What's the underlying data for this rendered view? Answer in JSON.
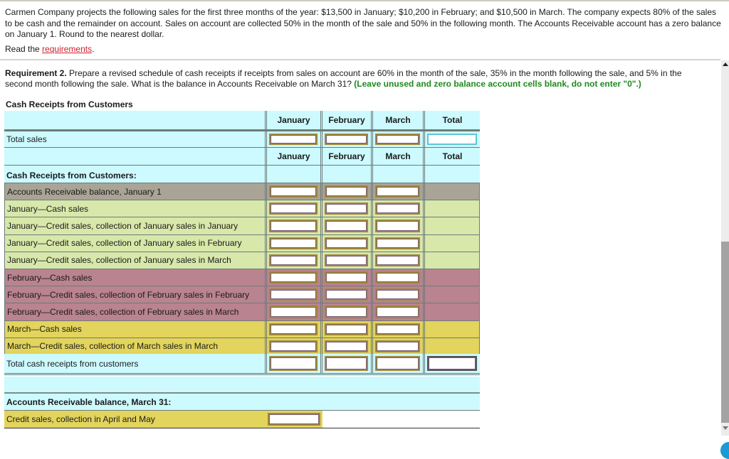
{
  "problem": {
    "intro": "Carmen Company projects the following sales for the first three months of the year: $13,500 in January; $10,200 in February; and $10,500 in March. The company expects 80% of the sales to be cash and the remainder on account. Sales on account are collected 50% in the month of the sale and 50% in the following month. The Accounts Receivable account has a zero balance on January 1. Round to the nearest dollar.",
    "read_prefix": "Read the ",
    "requirements_link": "requirements",
    "read_suffix": "."
  },
  "requirement": {
    "label": "Requirement 2.",
    "text": " Prepare a revised schedule of cash receipts if receipts from sales on account are 60% in the month of the sale, 35% in the month following the sale, and 5% in the second month following the sale. What is the balance in Accounts Receivable on March 31? ",
    "instruction": "(Leave unused and zero balance account cells blank, do not enter \"0\".)"
  },
  "schedule": {
    "title": "Cash Receipts from Customers",
    "columns": [
      "January",
      "February",
      "March",
      "Total"
    ],
    "total_sales_label": "Total sales",
    "total_sales_values": [
      "",
      "",
      "",
      ""
    ],
    "section_label": "Cash Receipts from Customers:",
    "rows": [
      {
        "label": "Accounts Receivable balance, January 1",
        "values": [
          "",
          "",
          ""
        ],
        "color": "#a9a496"
      },
      {
        "label": "January—Cash sales",
        "values": [
          "",
          "",
          ""
        ],
        "color": "#d8e8aa"
      },
      {
        "label": "January—Credit sales, collection of January sales in January",
        "values": [
          "",
          "",
          ""
        ],
        "color": "#d8e8aa"
      },
      {
        "label": "January—Credit sales, collection of January sales in February",
        "values": [
          "",
          "",
          ""
        ],
        "color": "#d8e8aa"
      },
      {
        "label": "January—Credit sales, collection of January sales in March",
        "values": [
          "",
          "",
          ""
        ],
        "color": "#d8e8aa"
      },
      {
        "label": "February—Cash sales",
        "values": [
          "",
          "",
          ""
        ],
        "color": "#b98390"
      },
      {
        "label": "February—Credit sales, collection of February sales in February",
        "values": [
          "",
          "",
          ""
        ],
        "color": "#b98390"
      },
      {
        "label": "February—Credit sales, collection of February sales in March",
        "values": [
          "",
          "",
          ""
        ],
        "color": "#b98390"
      },
      {
        "label": "March—Cash sales",
        "values": [
          "",
          "",
          ""
        ],
        "color": "#e2d45c"
      },
      {
        "label": "March—Credit sales, collection of March sales in March",
        "values": [
          "",
          "",
          ""
        ],
        "color": "#e2d45c"
      }
    ],
    "total_receipts_label": "Total cash receipts from customers",
    "total_receipts_values": [
      "",
      "",
      "",
      ""
    ],
    "ar_section_label": "Accounts Receivable balance, March 31:",
    "ar_row_label": "Credit sales, collection in April and May",
    "ar_row_value": ""
  },
  "colors": {
    "header_bg": "#ccfaff",
    "link": "#d0202a",
    "instruction": "#1e8a1e"
  }
}
